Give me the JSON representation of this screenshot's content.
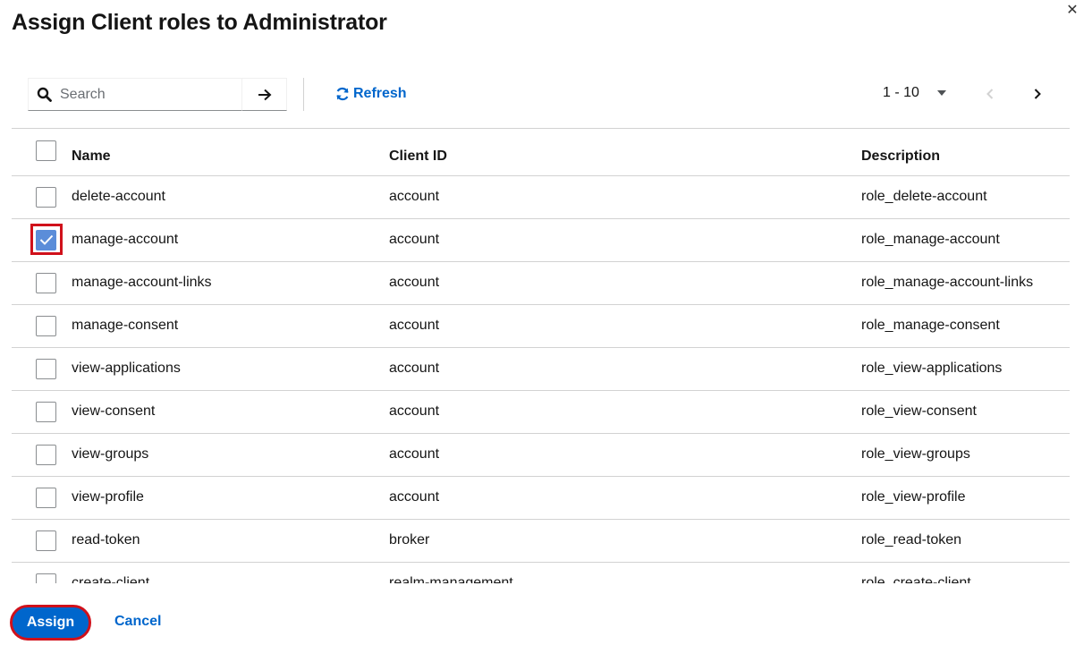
{
  "modal": {
    "title": "Assign Client roles to Administrator",
    "close_icon": "close-icon"
  },
  "toolbar": {
    "search_placeholder": "Search",
    "search_value": "",
    "refresh_label": "Refresh",
    "pagination_range": "1 - 10"
  },
  "table": {
    "headers": {
      "name": "Name",
      "client_id": "Client ID",
      "description": "Description"
    },
    "rows": [
      {
        "name": "delete-account",
        "client_id": "account",
        "description": "role_delete-account",
        "checked": false
      },
      {
        "name": "manage-account",
        "client_id": "account",
        "description": "role_manage-account",
        "checked": true
      },
      {
        "name": "manage-account-links",
        "client_id": "account",
        "description": "role_manage-account-links",
        "checked": false
      },
      {
        "name": "manage-consent",
        "client_id": "account",
        "description": "role_manage-consent",
        "checked": false
      },
      {
        "name": "view-applications",
        "client_id": "account",
        "description": "role_view-applications",
        "checked": false
      },
      {
        "name": "view-consent",
        "client_id": "account",
        "description": "role_view-consent",
        "checked": false
      },
      {
        "name": "view-groups",
        "client_id": "account",
        "description": "role_view-groups",
        "checked": false
      },
      {
        "name": "view-profile",
        "client_id": "account",
        "description": "role_view-profile",
        "checked": false
      },
      {
        "name": "read-token",
        "client_id": "broker",
        "description": "role_read-token",
        "checked": false
      },
      {
        "name": "create-client",
        "client_id": "realm-management",
        "description": "role_create-client",
        "checked": false
      }
    ]
  },
  "footer": {
    "assign_label": "Assign",
    "cancel_label": "Cancel"
  },
  "colors": {
    "primary": "#0066cc",
    "checkbox_checked": "#5b8dd9",
    "highlight": "#d0111b"
  }
}
